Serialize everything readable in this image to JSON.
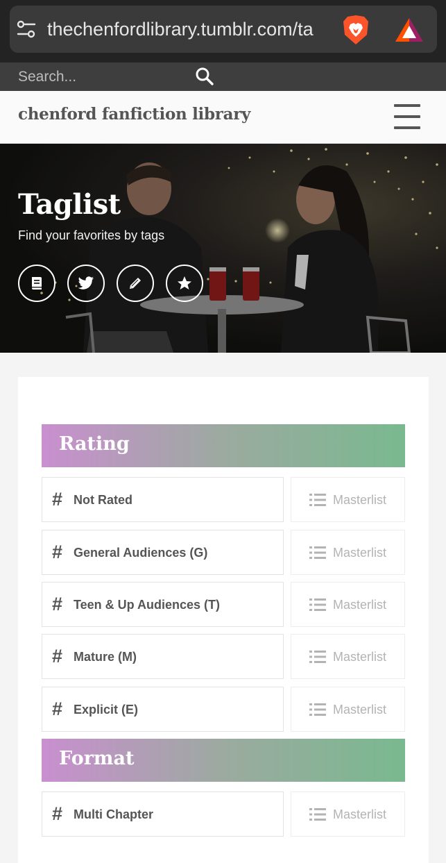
{
  "browser": {
    "url": "thechenfordlibrary.tumblr.com/ta"
  },
  "search": {
    "placeholder": "Search..."
  },
  "header": {
    "title": "chenford fanfiction library"
  },
  "hero": {
    "title": "Taglist",
    "subtitle": "Find your favorites by tags",
    "buttons": [
      "book-icon",
      "twitter-icon",
      "pencil-icon",
      "star-icon"
    ]
  },
  "sections": [
    {
      "title": "Rating",
      "tags": [
        {
          "label": "Not Rated",
          "masterlist": "Masterlist"
        },
        {
          "label": "General Audiences (G)",
          "masterlist": "Masterlist"
        },
        {
          "label": "Teen & Up Audiences (T)",
          "masterlist": "Masterlist"
        },
        {
          "label": "Mature (M)",
          "masterlist": "Masterlist"
        },
        {
          "label": "Explicit (E)",
          "masterlist": "Masterlist"
        }
      ]
    },
    {
      "title": "Format",
      "tags": [
        {
          "label": "Multi Chapter",
          "masterlist": "Masterlist"
        }
      ]
    }
  ],
  "symbols": {
    "hash": "#"
  },
  "colors": {
    "gradient_start": "#c98fcf",
    "gradient_end": "#79b98f",
    "chrome_bg": "#232323",
    "brave_orange": "#fb542b"
  }
}
